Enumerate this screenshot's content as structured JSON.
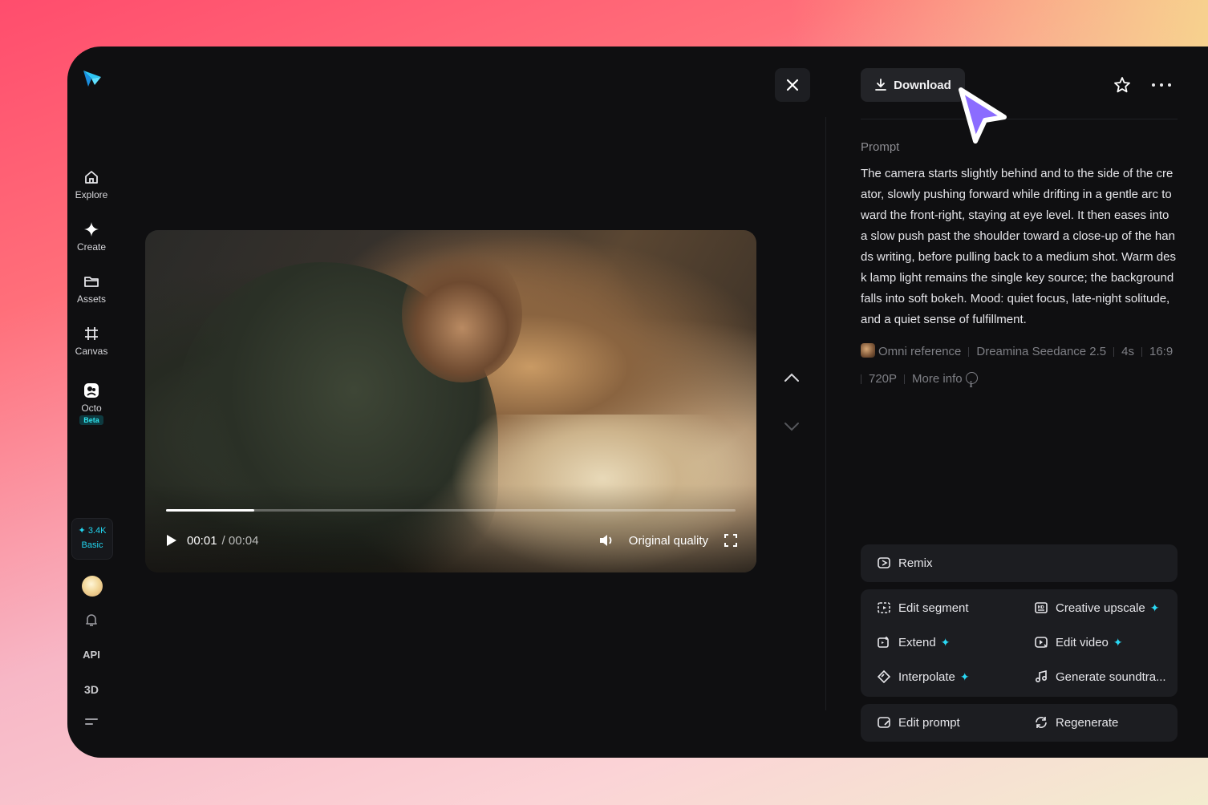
{
  "colors": {
    "accent": "#2ad9f5",
    "panel_bg": "#0f0f11",
    "card_bg": "#1c1d21",
    "cursor": "#8b6cff"
  },
  "sidebar": {
    "logo_icon": "paper-plane-logo-icon",
    "items": [
      {
        "label": "Explore",
        "icon": "home-icon"
      },
      {
        "label": "Create",
        "icon": "sparkle-icon"
      },
      {
        "label": "Assets",
        "icon": "folder-icon"
      },
      {
        "label": "Canvas",
        "icon": "frame-icon"
      },
      {
        "label": "Octo",
        "icon": "octo-icon",
        "badge": "Beta"
      }
    ],
    "credits": {
      "amount": "3.4K",
      "plan": "Basic"
    },
    "api_label": "API",
    "three_d_label": "3D"
  },
  "player": {
    "current_time": "00:01",
    "total_time": "/ 00:04",
    "quality": "Original quality",
    "progress": 0.155
  },
  "panel": {
    "download_label": "Download",
    "prompt_label": "Prompt",
    "prompt_text": "The camera starts slightly behind and to the side of the creator, slowly pushing forward while drifting in a gentle arc toward the front-right, staying at eye level. It then eases into a slow push past the shoulder toward a close-up of the hands writing, before pulling back to a medium shot. Warm desk lamp light remains the single key source; the background falls into soft bokeh. Mood: quiet focus, late-night solitude, and a quiet sense of fulfillment.",
    "meta": {
      "reference": "Omni reference",
      "model": "Dreamina Seedance 2.5",
      "duration": "4s",
      "ratio": "16:9",
      "resolution": "720P",
      "more_info": "More info"
    },
    "actions": {
      "remix": "Remix",
      "edit_segment": "Edit segment",
      "creative_upscale": "Creative upscale",
      "extend": "Extend",
      "edit_video": "Edit video",
      "interpolate": "Interpolate",
      "generate_soundtrack": "Generate soundtra...",
      "edit_prompt": "Edit prompt",
      "regenerate": "Regenerate"
    },
    "spark_glyph": "✦"
  }
}
